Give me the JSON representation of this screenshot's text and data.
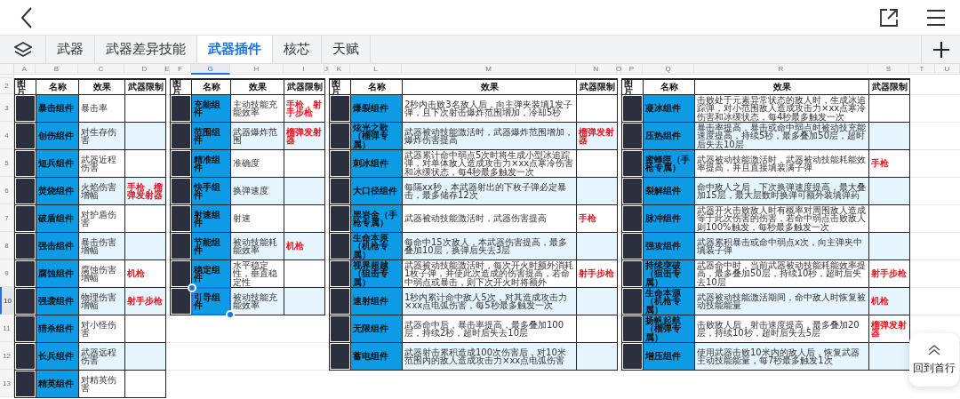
{
  "tabs": [
    {
      "label": "武器",
      "selected": false
    },
    {
      "label": "武器差异技能",
      "selected": false
    },
    {
      "label": "武器插件",
      "selected": true
    },
    {
      "label": "核芯",
      "selected": false
    },
    {
      "label": "天赋",
      "selected": false
    }
  ],
  "sheet": {
    "column_letters": [
      "A",
      "B",
      "C",
      "D",
      "E",
      "F",
      "G",
      "H",
      "I",
      "J",
      "K",
      "L",
      "M",
      "N",
      "O",
      "P",
      "Q",
      "R",
      "S",
      "T",
      "U"
    ],
    "row_numbers": [
      "2",
      "3",
      "4",
      "5",
      "6",
      "7",
      "8",
      "9",
      "10",
      "11",
      "12",
      "13"
    ],
    "tables": [
      {
        "headers": [
          "图片",
          "名称",
          "效果",
          "武器限制"
        ],
        "rows": [
          {
            "name": "暴击组件",
            "effect": "暴击率",
            "selected": false
          },
          {
            "name": "创伤组件",
            "effect": "对生存伤害",
            "selected": false
          },
          {
            "name": "短兵组件",
            "effect": "武器近程伤害",
            "selected": false
          },
          {
            "name": "焚烧组件",
            "effect": "火焰伤害增幅",
            "restriction": "手枪，榴弹发射器",
            "selected": false
          },
          {
            "name": "破盾组件",
            "effect": "对护盾伤害",
            "selected": false
          },
          {
            "name": "强击组件",
            "effect": "暴击伤害增幅",
            "selected": false
          },
          {
            "name": "腐蚀组件",
            "effect": "腐蚀伤害增幅",
            "restriction": "机枪",
            "selected": false
          },
          {
            "name": "强袭组件",
            "effect": "物理伤害增幅",
            "restriction": "射手步枪",
            "selected": false
          },
          {
            "name": "猎杀组件",
            "effect": "对小怪伤害",
            "selected": false
          },
          {
            "name": "长兵组件",
            "effect": "武器远程伤害",
            "selected": false
          },
          {
            "name": "精英组件",
            "effect": "对精英伤害",
            "selected": false
          }
        ]
      },
      {
        "headers": [
          "图片",
          "名称",
          "效果",
          "武器限制"
        ],
        "rows": [
          {
            "name": "充能组件",
            "effect": "主动技能充能效率",
            "restriction": "手枪，射手步枪",
            "selected": false
          },
          {
            "name": "范围组件",
            "effect": "武器爆炸范围",
            "restriction": "榴弹发射器",
            "selected": false
          },
          {
            "name": "精准组件",
            "effect": "准确度",
            "selected": false
          },
          {
            "name": "快手组件",
            "effect": "换弹速度",
            "selected": false
          },
          {
            "name": "射速组件",
            "effect": "射速",
            "selected": false
          },
          {
            "name": "节能组件",
            "effect": "被动技能耗能效率",
            "restriction": "机枪",
            "selected": false
          },
          {
            "name": "稳定组件",
            "effect": "水平稳定性，垂直稳定性",
            "selected": false
          },
          {
            "name": "引导组件",
            "effect": "被动技能充能效率",
            "selected": true
          }
        ]
      },
      {
        "headers": [
          "图片",
          "名称",
          "效果",
          "武器限制"
        ],
        "rows": [
          {
            "name": "爆裂组件",
            "effect": "2秒内击败3名敌人后，向主弹夹装填1发子弹，且下次射击爆炸范围增加，冷却5秒",
            "selected": false
          },
          {
            "name": "炫光之歌（榴弹专属）",
            "effect": "武器被动技能激活时，武器爆炸范围增加，爆炸伤害提高",
            "restriction": "榴弹发射器",
            "selected": false
          },
          {
            "name": "刺冰组件",
            "effect": "武器累计命中弱点5次时将生成小型冰追踪弹，对单体敌人造成攻击力×xx点寒冷伤害和冰缓状态，每4秒最多触发一次",
            "selected": false
          },
          {
            "name": "大口径组件",
            "effect": "每隔xx秒，本武器射出的下枚子弹必定暴击，最多储存12次",
            "selected": false
          },
          {
            "name": "黑岩金（手枪专属）",
            "effect": "武器被动技能激活时，武器伤害提高",
            "restriction": "手枪",
            "selected": false
          },
          {
            "name": "生命本原（机枪专属）",
            "effect": "每命中15次敌人，本武器伤害提高，最多叠加10层，换弹后失去3层",
            "selected": false
          },
          {
            "name": "视界超越（狙击专属）",
            "effect": "武器被动技能激活时，每次开火时额外消耗1枚子弹，并使此次造成的伤害提高，若命中弱点或暴击，则下次开火时将额外",
            "restriction": "射手步枪",
            "selected": false
          },
          {
            "name": "速射组件",
            "effect": "1秒内累计命中敌人5次，对其造成攻击力×xx点电弧伤害，每5秒最多触发一次",
            "selected": false
          },
          {
            "name": "无限组件",
            "effect": "武器命中后，暴击率提高，最多叠加100层，持续2秒，超时后失去10层",
            "selected": false
          },
          {
            "name": "蓄电组件",
            "effect": "武器射击累积造成100次伤害后，对10米范围内的敌人造成攻击力×xx点电弧伤害",
            "selected": false
          }
        ]
      },
      {
        "headers": [
          "图片",
          "名称",
          "效果",
          "武器限制"
        ],
        "rows": [
          {
            "name": "凝冰组件",
            "effect": "击败处于元素异常状态的敌人时，生成冰追踪弹，对小范围敌人造成攻击力×xx点寒冷伤害和冰缓状态，每4秒最多触发一次",
            "selected": false
          },
          {
            "name": "压热组件",
            "effect": "暴击率提高，暴击或命中弱点时被动技充能速度提高，持续5秒，最多叠加50层，超时后失去10层",
            "selected": false
          },
          {
            "name": "蜜蜂匣（手枪专属）",
            "effect": "武器被动技能激活时，武器被动技能耗能效率提高，并且直接填装满子弹",
            "restriction": "手枪",
            "selected": false
          },
          {
            "name": "裂解组件",
            "effect": "命中敌人之后，下次换弹速度提高，最大叠加15层，最大层数时换弹可额外装填弹药",
            "selected": false
          },
          {
            "name": "脉冲组件",
            "effect": "武器开火击败敌人时有概率对周围敌人造成等于此次伤害的伤害，若命中弱点击败敌人则100%触发，每秒最多触发一次",
            "selected": false
          },
          {
            "name": "强攻组件",
            "effect": "武器累积暴击或命中弱点x次，向主弹夹中填装子弹",
            "selected": false
          },
          {
            "name": "持续突破（狙击专属）",
            "effect": "武器命中时，当前武器被动技能耗能效率提高，最多叠加50层，持续10秒，超时后失去10层",
            "restriction": "射手步枪",
            "selected": false
          },
          {
            "name": "生命本源（机枪专属）",
            "effect": "武器被动技能激活期间，命中敌人时恢复被动技能能量",
            "restriction": "机枪",
            "selected": false
          },
          {
            "name": "扬帆起航（榴弹专属）",
            "effect": "击败敌人后，射击速度提高，最多叠加20层，持续10秒，超时后失去5层",
            "restriction": "榴弹发射器",
            "selected": false
          },
          {
            "name": "增压组件",
            "effect": "使用武器击败10米内的敌人后，恢复武器主动技能能量，每7秒最多触发1次",
            "selected": false
          }
        ]
      }
    ]
  },
  "back_to_top": {
    "label": "回到首行"
  }
}
